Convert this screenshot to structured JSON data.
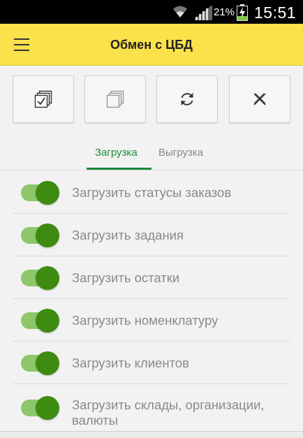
{
  "status_bar": {
    "battery_percent": "21%",
    "time": "15:51",
    "icons": [
      "wifi-icon",
      "signal-icon",
      "battery-charging-icon"
    ]
  },
  "header": {
    "title": "Обмен с ЦБД",
    "menu_icon": "hamburger-menu-icon",
    "background": "#fbe24a"
  },
  "toolbar": {
    "buttons": [
      {
        "name": "select-all-button",
        "icon": "checked-copy-icon"
      },
      {
        "name": "copy-button",
        "icon": "copy-icon"
      },
      {
        "name": "sync-button",
        "icon": "refresh-icon"
      },
      {
        "name": "close-button",
        "icon": "close-icon"
      }
    ]
  },
  "tabs": {
    "items": [
      {
        "label": "Загрузка",
        "active": true
      },
      {
        "label": "Выгрузка",
        "active": false
      }
    ],
    "accent": "#1c8a3a"
  },
  "options": {
    "items": [
      {
        "label": "Загрузить статусы заказов",
        "enabled": true
      },
      {
        "label": "Загрузить задания",
        "enabled": true
      },
      {
        "label": "Загрузить остатки",
        "enabled": true
      },
      {
        "label": "Загрузить номенклатуру",
        "enabled": true
      },
      {
        "label": "Загрузить клиентов",
        "enabled": true
      },
      {
        "label": "Загрузить склады, организации, валюты",
        "enabled": true
      }
    ],
    "switch_on_color": "#3e8b12"
  }
}
